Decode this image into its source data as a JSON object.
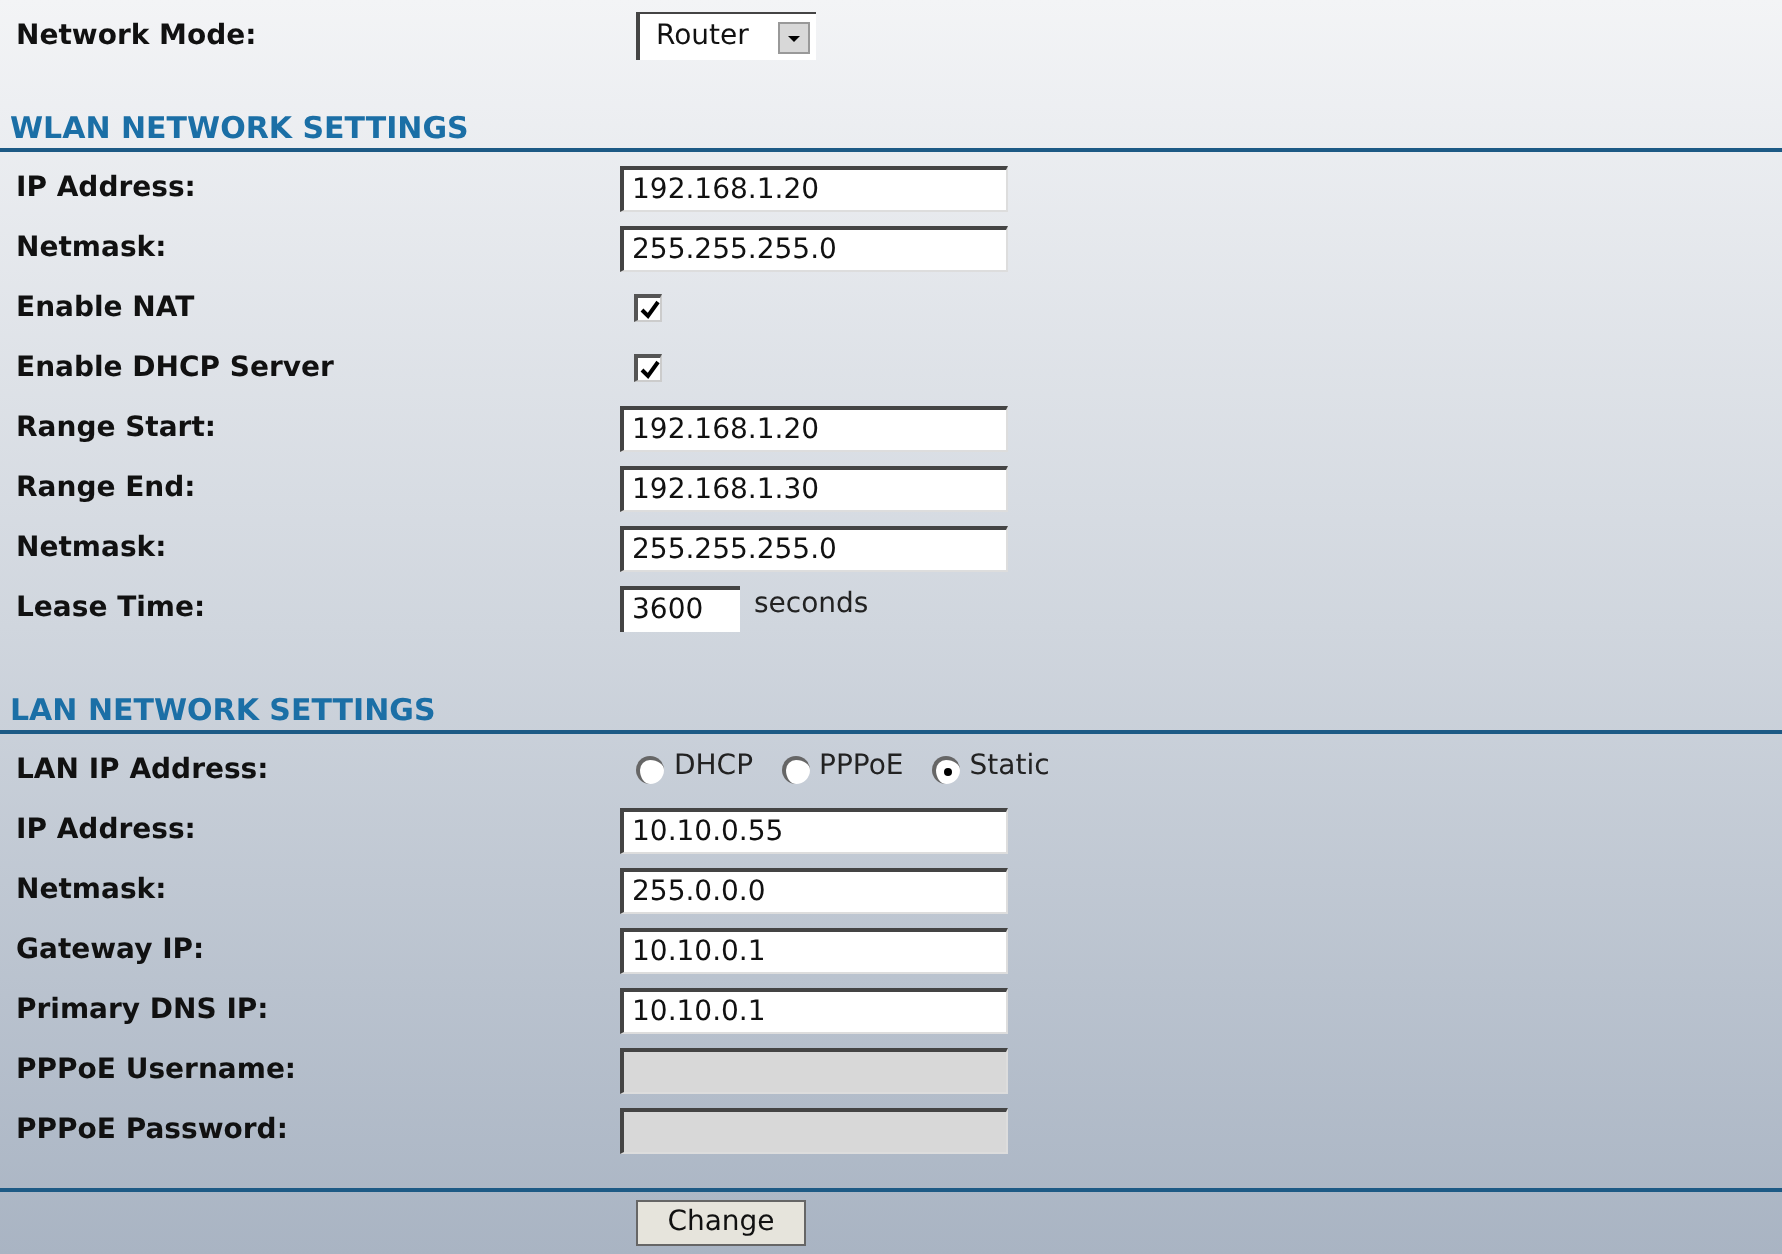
{
  "network_mode": {
    "label": "Network Mode:",
    "value": "Router"
  },
  "sections": [
    {
      "title": "WLAN NETWORK SETTINGS",
      "fields": [
        {
          "kind": "text",
          "label": "IP Address:",
          "value": "192.168.1.20",
          "disabled": false
        },
        {
          "kind": "text",
          "label": "Netmask:",
          "value": "255.255.255.0",
          "disabled": false
        },
        {
          "kind": "checkbox",
          "label": "Enable NAT",
          "checked": true
        },
        {
          "kind": "checkbox",
          "label": "Enable DHCP Server",
          "checked": true
        },
        {
          "kind": "text",
          "label": "Range Start:",
          "value": "192.168.1.20",
          "disabled": false
        },
        {
          "kind": "text",
          "label": "Range End:",
          "value": "192.168.1.30",
          "disabled": false
        },
        {
          "kind": "text",
          "label": "Netmask:",
          "value": "255.255.255.0",
          "disabled": false
        },
        {
          "kind": "unit",
          "label": "Lease Time:",
          "value": "3600",
          "unit": "seconds"
        }
      ]
    },
    {
      "title": "LAN NETWORK SETTINGS",
      "fields": [
        {
          "kind": "radio",
          "label": "LAN IP Address:",
          "options": [
            {
              "label": "DHCP",
              "selected": false
            },
            {
              "label": "PPPoE",
              "selected": false
            },
            {
              "label": "Static",
              "selected": true
            }
          ]
        },
        {
          "kind": "text",
          "label": "IP Address:",
          "value": "10.10.0.55",
          "disabled": false
        },
        {
          "kind": "text",
          "label": "Netmask:",
          "value": "255.0.0.0",
          "disabled": false
        },
        {
          "kind": "text",
          "label": "Gateway IP:",
          "value": "10.10.0.1",
          "disabled": false
        },
        {
          "kind": "text",
          "label": "Primary DNS IP:",
          "value": "10.10.0.1",
          "disabled": false
        },
        {
          "kind": "text",
          "label": "PPPoE Username:",
          "disabled": true
        },
        {
          "kind": "text",
          "label": "PPPoE Password:",
          "disabled": true
        }
      ]
    }
  ],
  "button": "Change"
}
